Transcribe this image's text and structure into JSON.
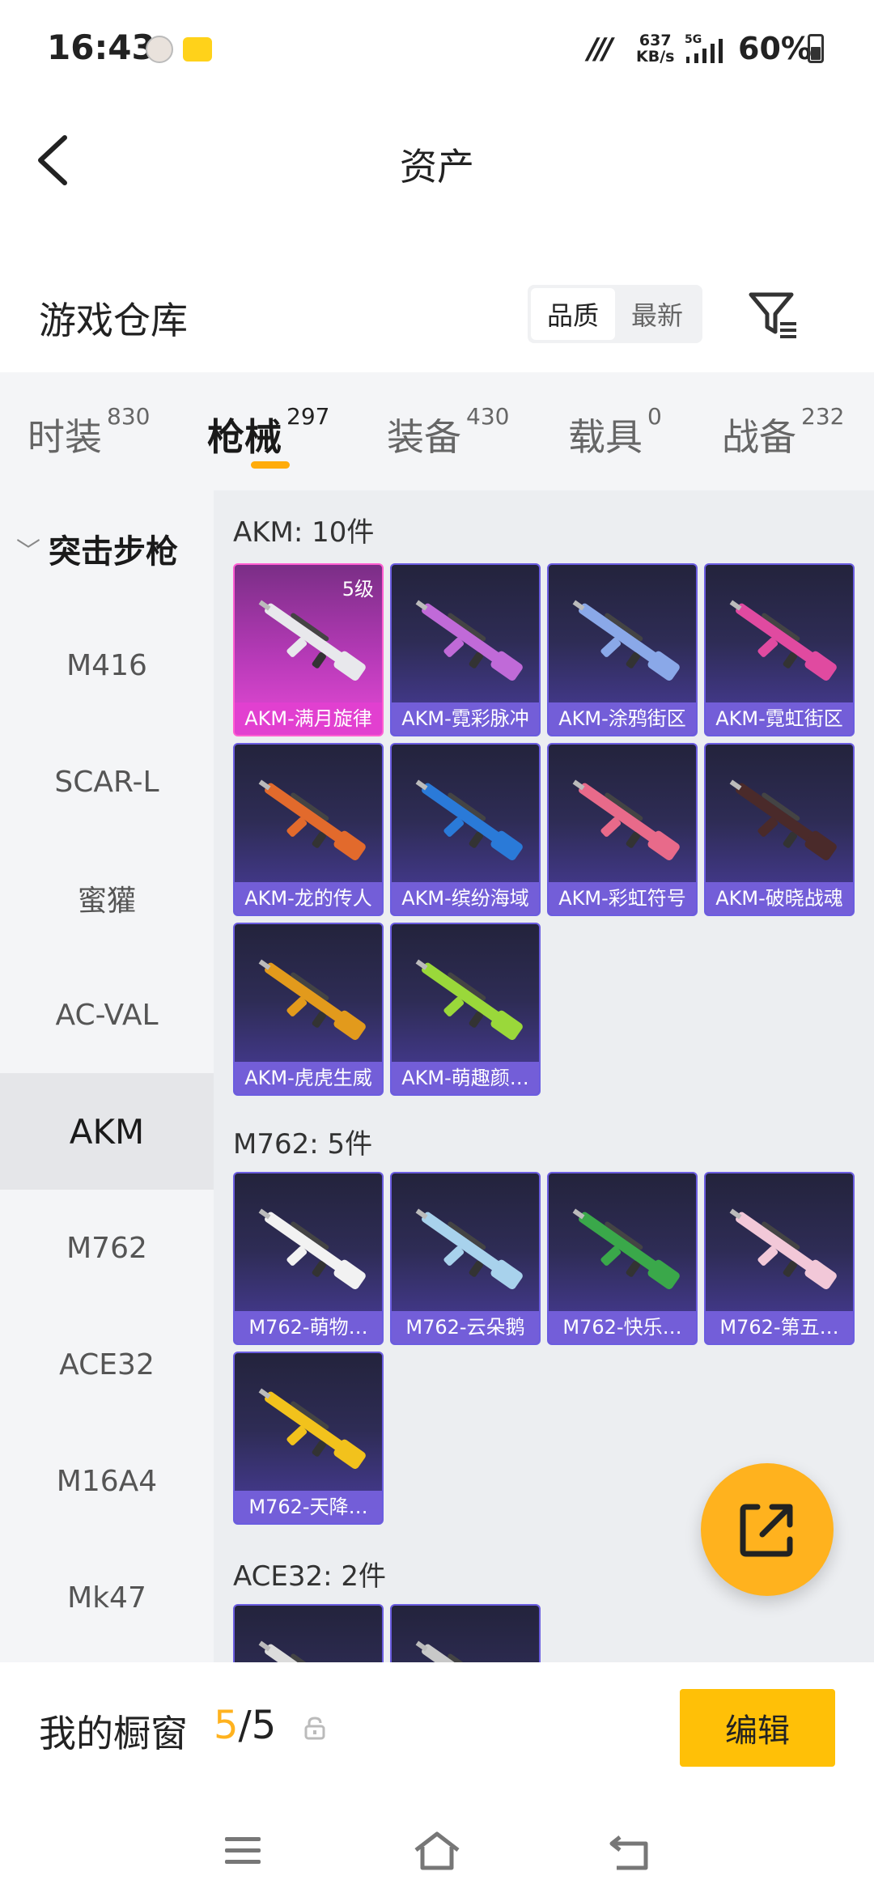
{
  "status_bar": {
    "time": "16:43",
    "net_logo": "///",
    "net_speed_value": "637",
    "net_speed_unit": "KB/s",
    "network": "5G",
    "battery": "60%"
  },
  "header": {
    "title": "资产"
  },
  "warehouse": {
    "title": "游戏仓库",
    "sort_options": [
      "品质",
      "最新"
    ],
    "sort_active": "品质"
  },
  "category_tabs": [
    {
      "label": "时装",
      "count": "830"
    },
    {
      "label": "枪械",
      "count": "297",
      "active": true
    },
    {
      "label": "装备",
      "count": "430"
    },
    {
      "label": "载具",
      "count": "0"
    },
    {
      "label": "战备",
      "count": "232"
    }
  ],
  "sidebar": {
    "group": "突击步枪",
    "items": [
      "M416",
      "SCAR-L",
      "蜜獾",
      "AC-VAL",
      "AKM",
      "M762",
      "ACE32",
      "M16A4",
      "Mk47"
    ],
    "active": "AKM"
  },
  "sections": [
    {
      "title": "AKM: 10件",
      "items": [
        {
          "name": "AKM-满月旋律",
          "level": "5级",
          "rarity": "epic",
          "color": "#e8e8ec"
        },
        {
          "name": "AKM-霓彩脉冲",
          "color": "#c06ad8"
        },
        {
          "name": "AKM-涂鸦街区",
          "color": "#8aa8e8"
        },
        {
          "name": "AKM-霓虹街区",
          "color": "#e04aa0"
        },
        {
          "name": "AKM-龙的传人",
          "color": "#e26a2c"
        },
        {
          "name": "AKM-缤纷海域",
          "color": "#2a7ad8"
        },
        {
          "name": "AKM-彩虹符号",
          "color": "#e86a8a"
        },
        {
          "name": "AKM-破晓战魂",
          "color": "#4a2a2a"
        },
        {
          "name": "AKM-虎虎生威",
          "color": "#e29a1c"
        },
        {
          "name": "AKM-萌趣颜…",
          "color": "#9ad83a"
        }
      ]
    },
    {
      "title": "M762: 5件",
      "items": [
        {
          "name": "M762-萌物…",
          "color": "#f2f2f2"
        },
        {
          "name": "M762-云朵鹅",
          "color": "#a8d2ec"
        },
        {
          "name": "M762-快乐…",
          "color": "#3aa84a"
        },
        {
          "name": "M762-第五…",
          "color": "#f2c8d8"
        },
        {
          "name": "M762-天降…",
          "color": "#f2c21c"
        }
      ]
    },
    {
      "title": "ACE32: 2件",
      "items": [
        {
          "name": "",
          "color": "#dcdcdc"
        },
        {
          "name": "",
          "color": "#c8c8c8"
        }
      ]
    }
  ],
  "showcase": {
    "label": "我的橱窗",
    "count_current": "5",
    "count_total": "/5",
    "edit_label": "编辑"
  },
  "colors": {
    "accent": "#ffb21e",
    "edit_button": "#ffc007",
    "tab_indicator": "#ffac0a"
  }
}
